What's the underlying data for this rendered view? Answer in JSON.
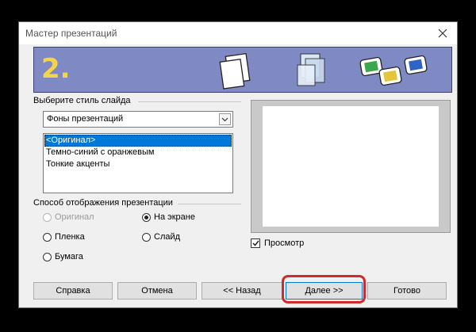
{
  "window": {
    "title": "Мастер презентаций"
  },
  "banner": {
    "step": "2."
  },
  "style_group": {
    "label": "Выберите стиль слайда",
    "combo_value": "Фоны презентаций",
    "items": [
      {
        "label": "<Оригинал>",
        "selected": true
      },
      {
        "label": "Темно-синий с оранжевым",
        "selected": false
      },
      {
        "label": "Тонкие акценты",
        "selected": false
      }
    ]
  },
  "output_group": {
    "label": "Способ отображения презентации",
    "options": [
      {
        "label": "Оригинал",
        "checked": false,
        "disabled": true
      },
      {
        "label": "На экране",
        "checked": true,
        "disabled": false
      },
      {
        "label": "Пленка",
        "checked": false,
        "disabled": false
      },
      {
        "label": "Слайд",
        "checked": false,
        "disabled": false
      },
      {
        "label": "Бумага",
        "checked": false,
        "disabled": false
      }
    ]
  },
  "preview": {
    "checkbox_label": "Просмотр",
    "checked": true
  },
  "buttons": {
    "help": "Справка",
    "cancel": "Отмена",
    "back": "<< Назад",
    "next": "Далее >>",
    "finish": "Готово"
  }
}
